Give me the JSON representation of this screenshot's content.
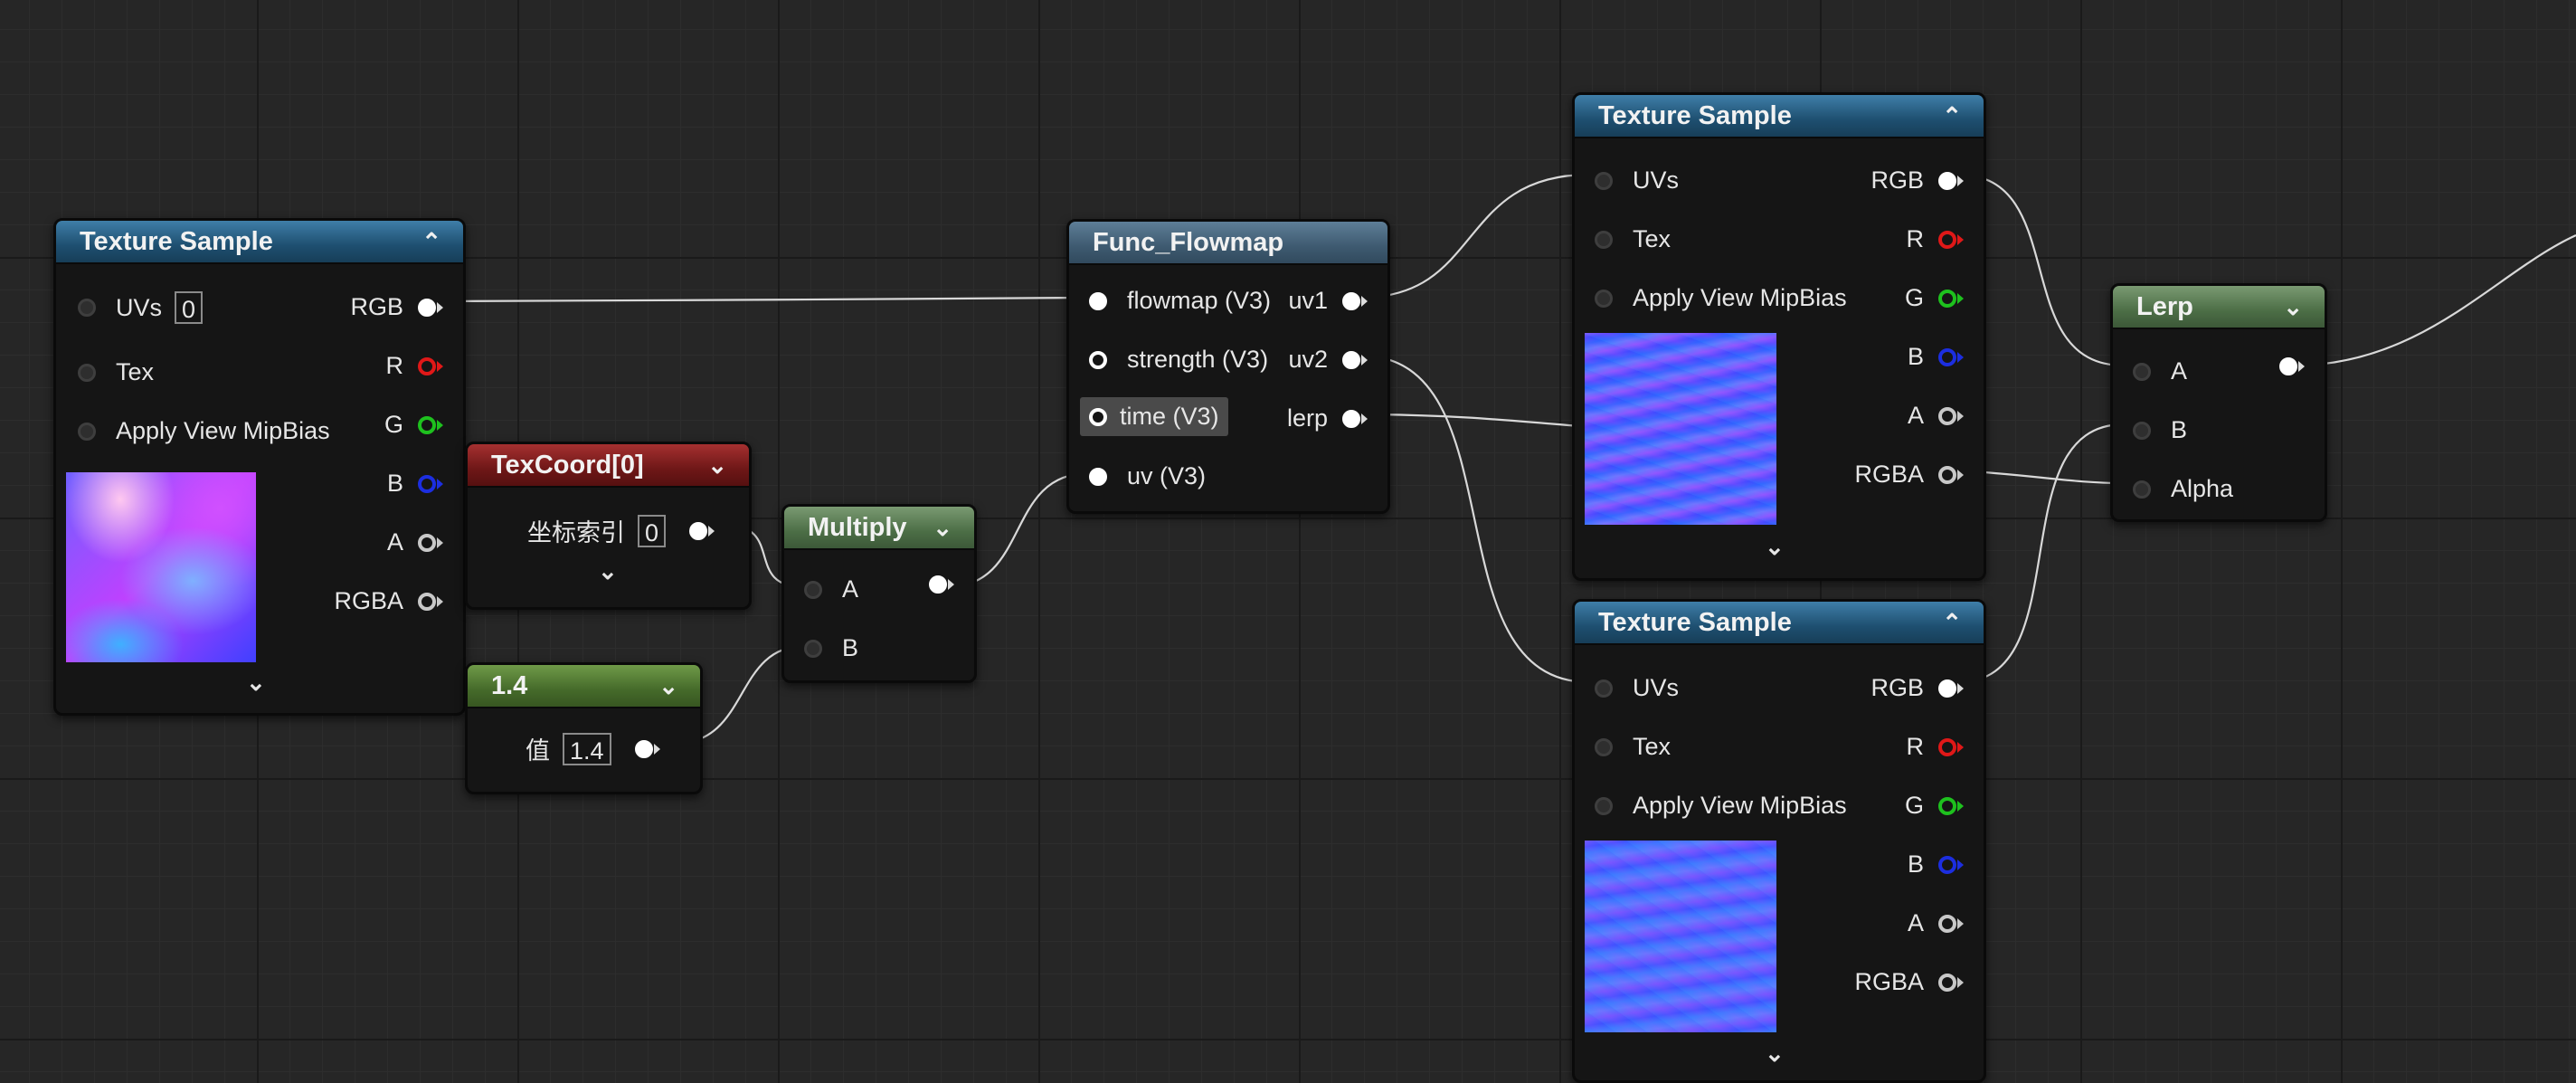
{
  "nodes": {
    "tex_a": {
      "title": "Texture Sample",
      "inputs": {
        "uvs": "UVs",
        "uvs_value": "0",
        "tex": "Tex",
        "mip": "Apply View MipBias"
      },
      "outputs": {
        "rgb": "RGB",
        "r": "R",
        "g": "G",
        "b": "B",
        "a": "A",
        "rgba": "RGBA"
      }
    },
    "texcoord": {
      "title": "TexCoord[0]",
      "label": "坐标索引",
      "value": "0"
    },
    "const": {
      "title": "1.4",
      "label": "值",
      "value": "1.4"
    },
    "multiply": {
      "title": "Multiply",
      "in_a": "A",
      "in_b": "B"
    },
    "flowmap": {
      "title": "Func_Flowmap",
      "inputs": {
        "flowmap": "flowmap (V3)",
        "strength": "strength (V3)",
        "time": "time (V3)",
        "uv": "uv (V3)"
      },
      "outputs": {
        "uv1": "uv1",
        "uv2": "uv2",
        "lerp": "lerp"
      }
    },
    "tex_b": {
      "title": "Texture Sample",
      "inputs": {
        "uvs": "UVs",
        "tex": "Tex",
        "mip": "Apply View MipBias"
      },
      "outputs": {
        "rgb": "RGB",
        "r": "R",
        "g": "G",
        "b": "B",
        "a": "A",
        "rgba": "RGBA"
      }
    },
    "tex_c": {
      "title": "Texture Sample",
      "inputs": {
        "uvs": "UVs",
        "tex": "Tex",
        "mip": "Apply View MipBias"
      },
      "outputs": {
        "rgb": "RGB",
        "r": "R",
        "g": "G",
        "b": "B",
        "a": "A",
        "rgba": "RGBA"
      }
    },
    "lerp": {
      "title": "Lerp",
      "in_a": "A",
      "in_b": "B",
      "alpha": "Alpha"
    }
  },
  "colors": {
    "wire": "#d8d8d8",
    "pin_red": "#e01818",
    "pin_green": "#1ec11e",
    "pin_blue": "#1c2ee0",
    "header_texture": "#2a6386",
    "header_texcoord": "#8a2222",
    "header_constant": "#5a8a36",
    "header_multiply": "#5e8458",
    "header_function": "#4a6a84"
  }
}
